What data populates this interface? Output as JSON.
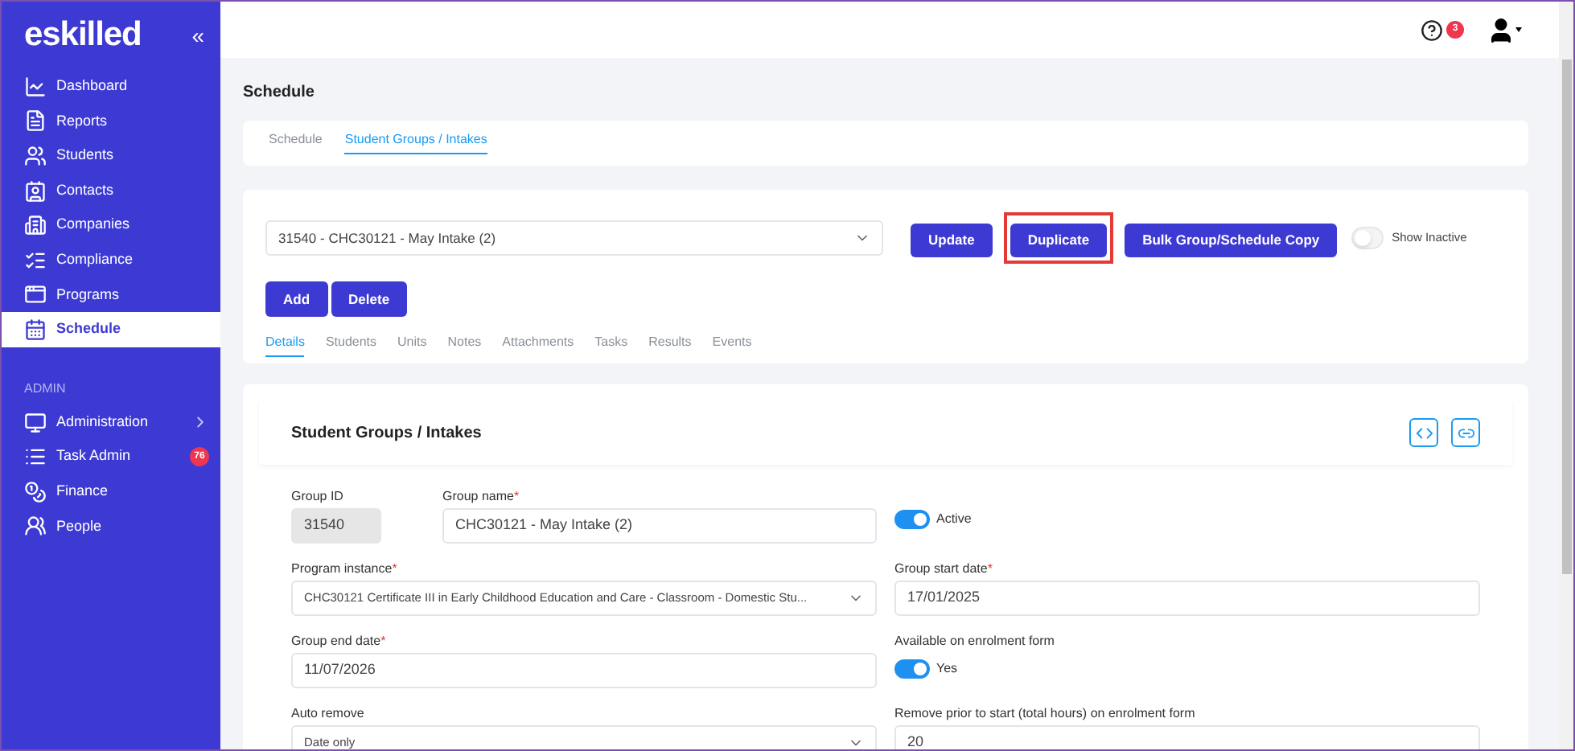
{
  "sidebar": {
    "logo": "eskilled",
    "collapse": "«",
    "items": [
      {
        "label": "Dashboard",
        "selected": false
      },
      {
        "label": "Reports",
        "selected": false
      },
      {
        "label": "Students",
        "selected": false
      },
      {
        "label": "Contacts",
        "selected": false
      },
      {
        "label": "Companies",
        "selected": false
      },
      {
        "label": "Compliance",
        "selected": false
      },
      {
        "label": "Programs",
        "selected": false
      },
      {
        "label": "Schedule",
        "selected": true
      }
    ],
    "section": "ADMIN",
    "admin_items": [
      {
        "label": "Administration",
        "expandable": true
      },
      {
        "label": "Task Admin",
        "badge": "76"
      },
      {
        "label": "Finance"
      },
      {
        "label": "People"
      }
    ]
  },
  "header": {
    "help_badge": "3"
  },
  "page_title": "Schedule",
  "top_tabs": [
    {
      "label": "Schedule",
      "selected": false
    },
    {
      "label": "Student Groups / Intakes",
      "selected": true
    }
  ],
  "group_select": {
    "value": "31540 - CHC30121 - May Intake (2)"
  },
  "actions": [
    {
      "label": "Update",
      "highlighted": false
    },
    {
      "label": "Duplicate",
      "highlighted": true
    },
    {
      "label": "Bulk Group/Schedule Copy",
      "highlighted": false
    }
  ],
  "show_inactive": {
    "label": "Show Inactive",
    "on": false
  },
  "row_buttons": [
    "Add",
    "Delete"
  ],
  "detail_tabs": [
    {
      "label": "Details",
      "selected": true
    },
    {
      "label": "Students",
      "selected": false
    },
    {
      "label": "Units",
      "selected": false
    },
    {
      "label": "Notes",
      "selected": false
    },
    {
      "label": "Attachments",
      "selected": false
    },
    {
      "label": "Tasks",
      "selected": false
    },
    {
      "label": "Results",
      "selected": false
    },
    {
      "label": "Events",
      "selected": false
    }
  ],
  "form": {
    "title": "Student Groups / Intakes",
    "group_id": {
      "label": "Group ID",
      "value": "31540"
    },
    "group_name": {
      "label": "Group name",
      "value": "CHC30121 - May Intake (2)",
      "required_mark": "*"
    },
    "active": {
      "label": "Active",
      "on": true
    },
    "program_instance": {
      "label": "Program instance",
      "value": "CHC30121 Certificate III in Early Childhood Education and Care - Classroom - Domestic Stu...",
      "required_mark": "*"
    },
    "start_date": {
      "label": "Group start date",
      "value": "17/01/2025",
      "required_mark": "*"
    },
    "end_date": {
      "label": "Group end date",
      "value": "11/07/2026",
      "required_mark": "*"
    },
    "enrolment": {
      "label": "Available on enrolment form",
      "toggle_label": "Yes",
      "on": true
    },
    "auto_remove": {
      "label": "Auto remove",
      "value": "Date only"
    },
    "remove_prior": {
      "label": "Remove prior to start (total hours) on enrolment form",
      "value": "20"
    }
  }
}
